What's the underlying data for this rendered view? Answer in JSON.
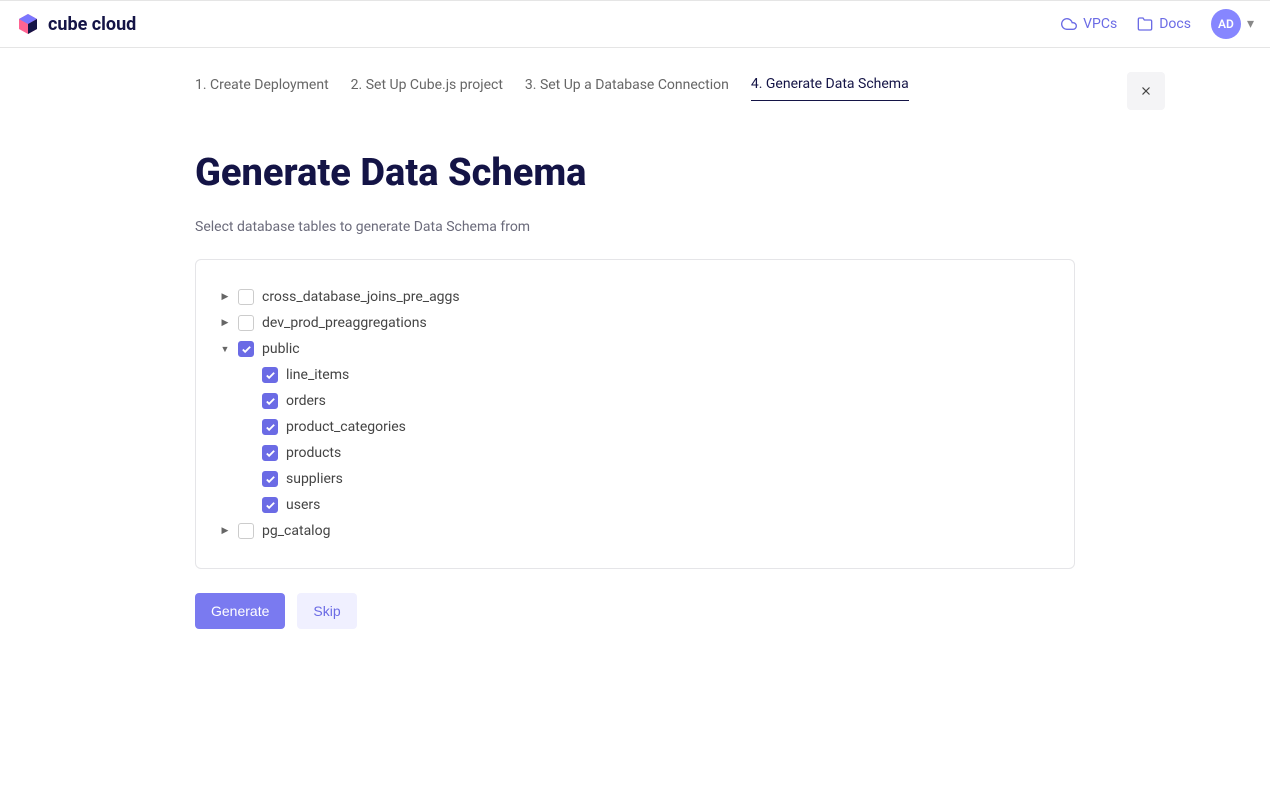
{
  "header": {
    "logo_text": "cube cloud",
    "vpcs_label": "VPCs",
    "docs_label": "Docs",
    "avatar_initials": "AD"
  },
  "wizard": {
    "steps": [
      "1. Create Deployment",
      "2. Set Up Cube.js project",
      "3. Set Up a Database Connection",
      "4. Generate Data Schema"
    ],
    "active_index": 3
  },
  "page": {
    "title": "Generate Data Schema",
    "subtitle": "Select database tables to generate Data Schema from"
  },
  "tree": {
    "schemas": [
      {
        "name": "cross_database_joins_pre_aggs",
        "expanded": false,
        "checked": false
      },
      {
        "name": "dev_prod_preaggregations",
        "expanded": false,
        "checked": false
      },
      {
        "name": "public",
        "expanded": true,
        "checked": true,
        "tables": [
          {
            "name": "line_items",
            "checked": true
          },
          {
            "name": "orders",
            "checked": true
          },
          {
            "name": "product_categories",
            "checked": true
          },
          {
            "name": "products",
            "checked": true
          },
          {
            "name": "suppliers",
            "checked": true
          },
          {
            "name": "users",
            "checked": true
          }
        ]
      },
      {
        "name": "pg_catalog",
        "expanded": false,
        "checked": false
      }
    ]
  },
  "actions": {
    "generate_label": "Generate",
    "skip_label": "Skip"
  }
}
